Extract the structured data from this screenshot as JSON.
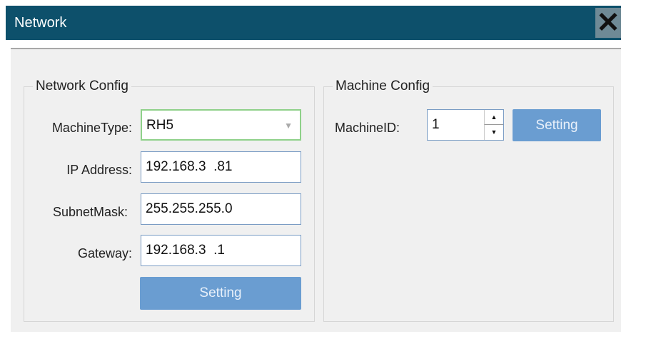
{
  "window": {
    "title": "Network",
    "close_icon": "close-icon"
  },
  "network_config": {
    "legend": "Network Config",
    "machine_type_label": "MachineType:",
    "machine_type_value": "RH5",
    "ip_label": "IP Address:",
    "ip_value": "192.168.3  .81",
    "subnet_label": "SubnetMask:",
    "subnet_value": "255.255.255.0",
    "gateway_label": "Gateway:",
    "gateway_value": "192.168.3  .1",
    "setting_label": "Setting"
  },
  "machine_config": {
    "legend": "Machine Config",
    "machine_id_label": "MachineID:",
    "machine_id_value": "1",
    "setting_label": "Setting"
  }
}
